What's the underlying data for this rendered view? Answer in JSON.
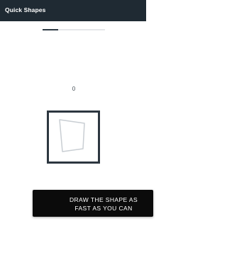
{
  "app_bar": {
    "title": "Quick Shapes"
  },
  "progress": {
    "fraction": 0.25
  },
  "game": {
    "score": "0",
    "shape_icon": "quadrilateral-outline"
  },
  "instruction": {
    "line1": "DRAW THE SHAPE AS",
    "line2": "FAST AS YOU CAN"
  },
  "colors": {
    "app_bar": "#1f2a33",
    "frame_border": "#2d3740",
    "shape_stroke": "#c9ced3",
    "instruction_bg": "#0b0b0b",
    "progress_fill": "#2d3a44",
    "progress_track": "#e5e7ea"
  }
}
